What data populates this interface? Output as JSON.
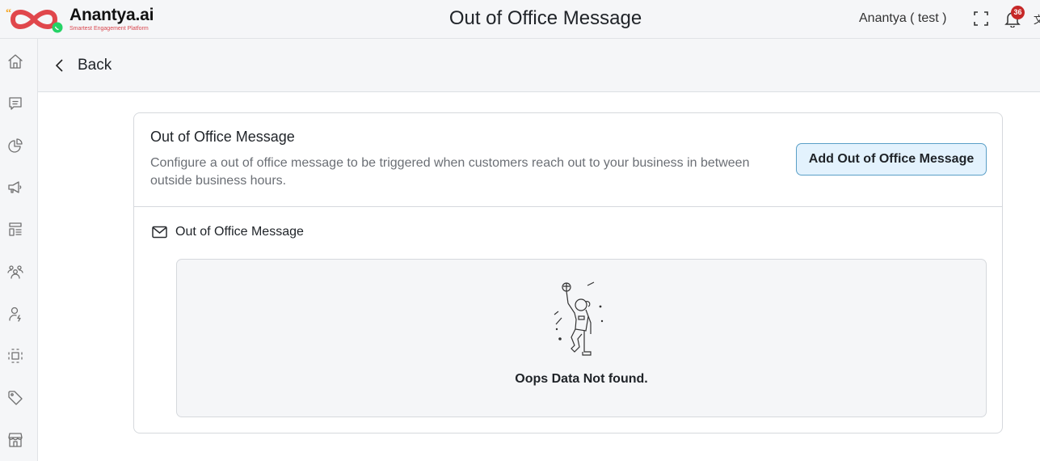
{
  "brand": {
    "name": "Anantya.ai",
    "tagline": "Smartest Engagement Platform",
    "colors": {
      "primary": "#e0474c",
      "whatsapp": "#25d366",
      "quote": "#f5a623"
    }
  },
  "header": {
    "title": "Out of Office Message",
    "user": "Anantya ( test )",
    "notification_count": "36",
    "icons": [
      "fullscreen-icon",
      "bell-icon"
    ]
  },
  "sidebar": {
    "items": [
      {
        "name": "home",
        "icon": "home-icon"
      },
      {
        "name": "chat",
        "icon": "chat-icon"
      },
      {
        "name": "analytics",
        "icon": "pie-chart-icon"
      },
      {
        "name": "campaigns",
        "icon": "megaphone-icon"
      },
      {
        "name": "templates",
        "icon": "layout-list-icon"
      },
      {
        "name": "contacts",
        "icon": "users-icon"
      },
      {
        "name": "agents",
        "icon": "user-bolt-icon"
      },
      {
        "name": "integrations",
        "icon": "focus-square-icon"
      },
      {
        "name": "tags",
        "icon": "tag-icon"
      },
      {
        "name": "store",
        "icon": "store-icon"
      }
    ]
  },
  "back": {
    "label": "Back"
  },
  "card": {
    "title": "Out of Office Message",
    "description": "Configure a out of office message to be triggered when customers reach out to your business in between outside business hours.",
    "add_button": "Add Out of Office Message",
    "section_label": "Out of Office Message",
    "empty_text": "Oops Data Not found."
  }
}
